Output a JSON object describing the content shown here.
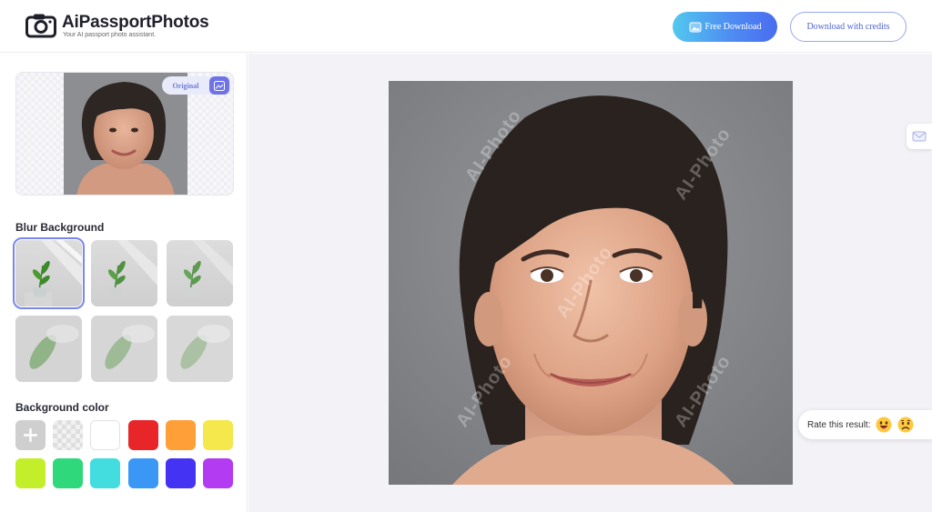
{
  "header": {
    "brand_name": "AiPassportPhotos",
    "tagline": "Your AI passport photo assistant.",
    "free_download_label": "Free Download",
    "credits_label": "Download with credits"
  },
  "sidebar": {
    "original_toggle_label": "Original",
    "blur_section_title": "Blur Background",
    "blur_options_count": 6,
    "blur_selected_index": 0,
    "color_section_title": "Background color",
    "colors": [
      "add",
      "transparent",
      "#ffffff",
      "#e8262a",
      "#ff9f38",
      "#f4e84c",
      "#c3ef2a",
      "#2fd87a",
      "#43dde0",
      "#3a97f6",
      "#4433f2",
      "#b33cf2"
    ]
  },
  "main": {
    "watermark_text": "AI-Photo"
  },
  "rating": {
    "label": "Rate this result:",
    "options": [
      "happy-face-icon",
      "sad-face-icon"
    ]
  }
}
